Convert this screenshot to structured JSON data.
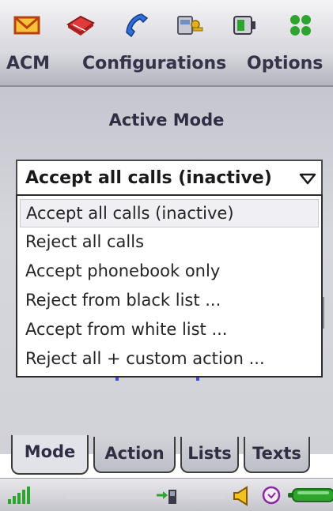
{
  "top_icons": [
    "envelope-icon",
    "book-icon",
    "phone-handset-icon",
    "key-card-icon",
    "battery-phone-icon",
    "apps-grid-icon"
  ],
  "menu": {
    "acm": "ACM",
    "configurations": "Configurations",
    "options": "Options"
  },
  "active_mode": {
    "title": "Active Mode",
    "selected": "Accept all calls (inactive)",
    "options": [
      "Accept all calls (inactive)",
      "Reject all calls",
      "Accept phonebook only",
      "Reject from black list ...",
      "Accept from white list ...",
      "Reject all + custom action ..."
    ]
  },
  "tabs": [
    {
      "label": "Mode",
      "active": true
    },
    {
      "label": "Action",
      "active": false
    },
    {
      "label": "Lists",
      "active": false
    },
    {
      "label": "Texts",
      "active": false
    }
  ],
  "status": {
    "icons": [
      "signal-strength-icon",
      "sim-transfer-icon",
      "speaker-icon",
      "clock-icon",
      "battery-icon"
    ]
  },
  "colors": {
    "accent_green": "#2ea32e",
    "selected_bg": "#f0f0f4"
  }
}
